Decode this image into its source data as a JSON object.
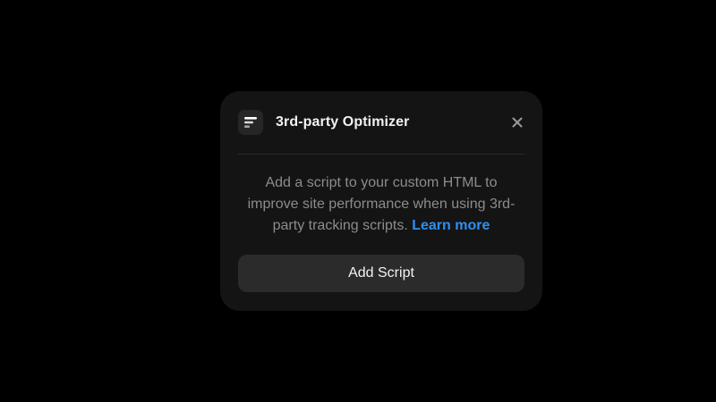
{
  "dialog": {
    "title": "3rd-party Optimizer",
    "app_icon": "optimizer-lines-icon",
    "close_icon": "close-icon",
    "description": "Add a script to your custom HTML to improve site performance when using 3rd-party tracking scripts.",
    "learn_more_label": "Learn more",
    "primary_button_label": "Add Script"
  },
  "colors": {
    "page_background": "#000000",
    "panel_background": "#141414",
    "button_background": "#2b2b2b",
    "link": "#2f8ff0",
    "body_text": "#8c8c8c",
    "title_text": "#f2f2f2"
  }
}
